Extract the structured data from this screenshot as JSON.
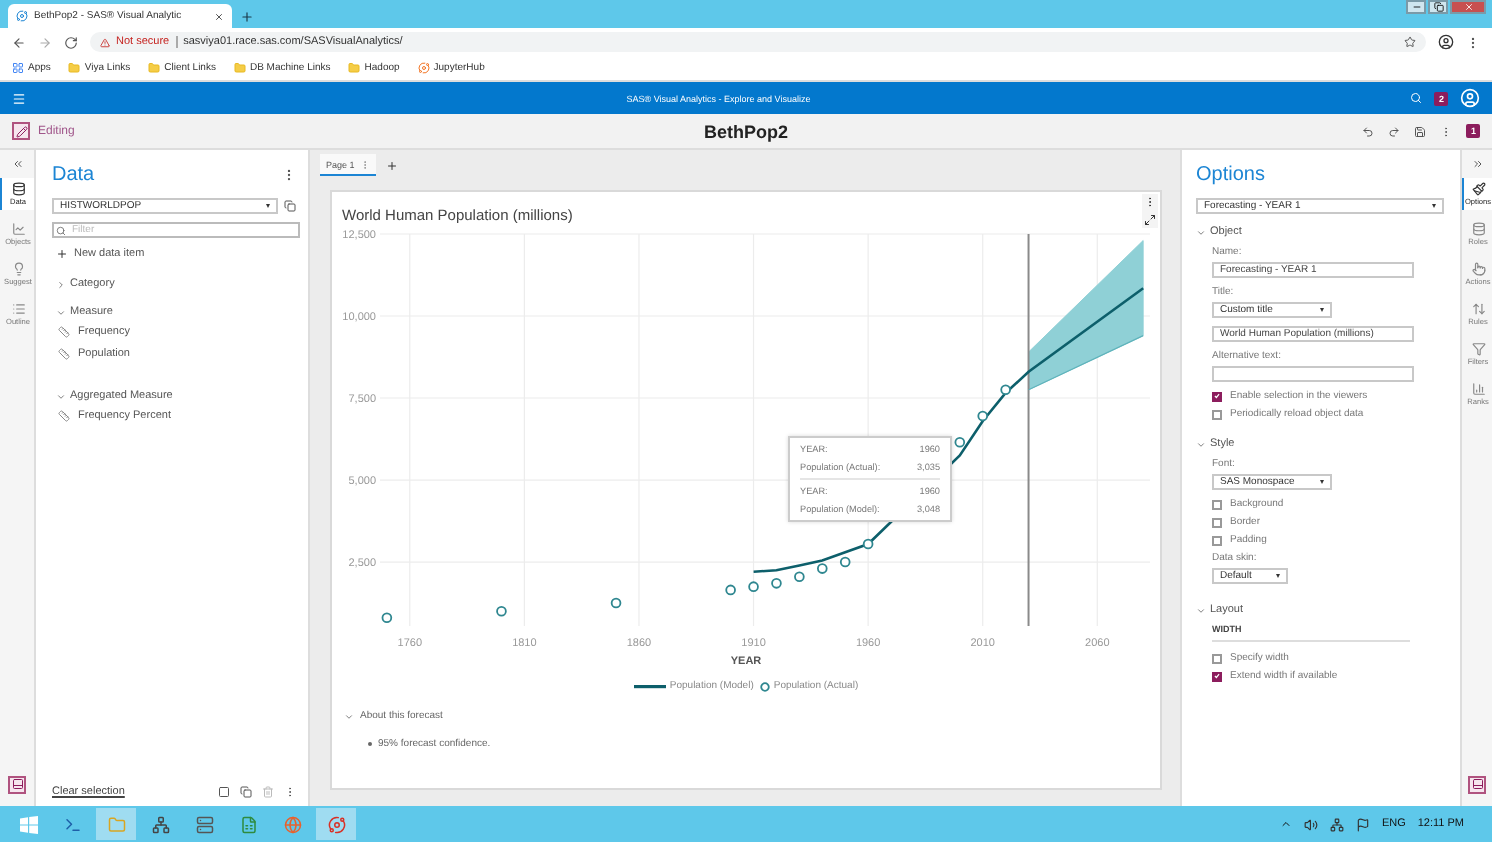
{
  "browser": {
    "tabs": [
      {
        "title": "BethPop2 - SAS® Visual Analytic",
        "selected": true
      }
    ],
    "address": {
      "security": "Not secure",
      "url": "sasviya01.race.sas.com/SASVisualAnalytics/"
    },
    "bookmarks": [
      {
        "label": "Apps",
        "kind": "apps"
      },
      {
        "label": "Viya Links",
        "kind": "folder"
      },
      {
        "label": "Client Links",
        "kind": "folder"
      },
      {
        "label": "DB Machine Links",
        "kind": "folder"
      },
      {
        "label": "Hadoop",
        "kind": "folder"
      },
      {
        "label": "JupyterHub",
        "kind": "site"
      }
    ]
  },
  "app_header": {
    "title": "SAS® Visual Analytics - Explore and Visualize",
    "notifications": "2"
  },
  "toolbar": {
    "mode": "Editing",
    "report_title": "BethPop2",
    "badge": "1"
  },
  "left_rail": {
    "items": [
      {
        "label": "Data",
        "selected": true
      },
      {
        "label": "Objects",
        "selected": false
      },
      {
        "label": "Suggest",
        "selected": false
      },
      {
        "label": "Outline",
        "selected": false
      }
    ]
  },
  "data_pane": {
    "title": "Data",
    "source": "HISTWORLDPOP",
    "filter_placeholder": "Filter",
    "new_item": "New data item",
    "groups": [
      {
        "label": "Category",
        "expanded": false
      },
      {
        "label": "Measure",
        "expanded": true,
        "children": [
          {
            "label": "Frequency"
          },
          {
            "label": "Population"
          }
        ]
      },
      {
        "label": "Aggregated Measure",
        "expanded": true,
        "children": [
          {
            "label": "Frequency Percent"
          }
        ]
      }
    ],
    "footer_link": "Clear selection"
  },
  "canvas": {
    "pages": [
      {
        "label": "Page 1",
        "selected": true
      }
    ],
    "chart": {
      "title": "World Human Population (millions)",
      "chart_data": {
        "type": "line",
        "xlabel": "YEAR",
        "xlim": [
          1747,
          2083
        ],
        "ylim": [
          550,
          12500
        ],
        "grid": true,
        "xticks": [
          1760,
          1810,
          1860,
          1910,
          1960,
          2010,
          2060
        ],
        "yticks": [
          {
            "value": 2500,
            "label": "2,500"
          },
          {
            "value": 5000,
            "label": "5,000"
          },
          {
            "value": 7500,
            "label": "7,500"
          },
          {
            "value": 10000,
            "label": "10,000"
          },
          {
            "value": 12500,
            "label": "12,500"
          }
        ],
        "x": [
          1750,
          1800,
          1850,
          1900,
          1910,
          1920,
          1930,
          1940,
          1950,
          1960,
          2000,
          2010,
          2020,
          2030,
          2080
        ],
        "series": [
          {
            "name": "Population (Model)",
            "type": "line",
            "color": "#0d5f6b",
            "values": [
              null,
              null,
              null,
              null,
              2200,
              2250,
              2400,
              2550,
              2800,
              3050,
              5750,
              6800,
              7650,
              8300,
              10850
            ]
          },
          {
            "name": "Population (Actual)",
            "type": "scatter",
            "color": "#2f8790",
            "values": [
              800,
              1000,
              1250,
              1650,
              1750,
              1850,
              2050,
              2300,
              2500,
              3050,
              6150,
              6950,
              7750,
              null,
              null
            ]
          },
          {
            "type": "area",
            "color": "#8fd0d6",
            "values": [
              null,
              null,
              null,
              null,
              null,
              null,
              null,
              null,
              null,
              null,
              null,
              null,
              null,
              8900,
              12300
            ]
          },
          {
            "type": "line",
            "color": "#5fb3bb",
            "values": [
              null,
              null,
              null,
              null,
              null,
              null,
              null,
              null,
              null,
              null,
              null,
              null,
              null,
              7750,
              9400
            ]
          }
        ],
        "ref_lines": [
          {
            "axis": "x",
            "value": 2030,
            "color": "#8a8a8a"
          }
        ]
      },
      "tooltip": [
        {
          "rows": [
            {
              "label": "YEAR:",
              "value": "1960"
            },
            {
              "label": "Population (Actual):",
              "value": "3,035"
            }
          ]
        },
        {
          "rows": [
            {
              "label": "YEAR:",
              "value": "1960"
            },
            {
              "label": "Population (Model):",
              "value": "3,048"
            }
          ]
        }
      ],
      "about": {
        "label": "About this forecast",
        "expanded": true,
        "items": [
          "95% forecast confidence."
        ]
      }
    }
  },
  "options_pane": {
    "title": "Options",
    "object_select": "Forecasting - YEAR 1",
    "sections": [
      {
        "label": "Object",
        "expanded": true,
        "fields": [
          {
            "kind": "text",
            "label": "Name:",
            "value": "Forecasting - YEAR 1"
          },
          {
            "kind": "select",
            "label": "Title:",
            "value": "Custom title"
          },
          {
            "kind": "text",
            "value": "World Human Population (millions)"
          },
          {
            "kind": "text",
            "label": "Alternative text:"
          },
          {
            "kind": "checkbox",
            "label": "Enable selection in the viewers",
            "checked": true
          },
          {
            "kind": "checkbox",
            "label": "Periodically reload object data",
            "checked": false
          }
        ]
      },
      {
        "label": "Style",
        "expanded": true,
        "fields": [
          {
            "kind": "select",
            "label": "Font:",
            "value": "SAS Monospace"
          },
          {
            "kind": "checkbox",
            "label": "Background",
            "checked": false
          },
          {
            "kind": "checkbox",
            "label": "Border",
            "checked": false
          },
          {
            "kind": "checkbox",
            "label": "Padding",
            "checked": false
          },
          {
            "kind": "select",
            "label": "Data skin:",
            "value": "Default",
            "short": true
          }
        ]
      },
      {
        "label": "Layout",
        "expanded": true,
        "fields": [
          {
            "kind": "heading",
            "label": "WIDTH"
          },
          {
            "kind": "checkbox",
            "label": "Specify width",
            "checked": false
          },
          {
            "kind": "checkbox",
            "label": "Extend width if available",
            "checked": true
          }
        ]
      }
    ]
  },
  "right_rail": {
    "items": [
      {
        "label": "Options",
        "selected": true
      },
      {
        "label": "Roles",
        "selected": false
      },
      {
        "label": "Actions",
        "selected": false
      },
      {
        "label": "Rules",
        "selected": false
      },
      {
        "label": "Filters",
        "selected": false
      },
      {
        "label": "Ranks",
        "selected": false
      }
    ]
  },
  "taskbar": {
    "apps": [
      {
        "selected": false
      },
      {
        "selected": true
      },
      {
        "selected": false
      },
      {
        "selected": false
      },
      {
        "selected": false
      },
      {
        "selected": false
      },
      {
        "selected": true
      }
    ],
    "language": "ENG",
    "time": "12:11 PM"
  }
}
